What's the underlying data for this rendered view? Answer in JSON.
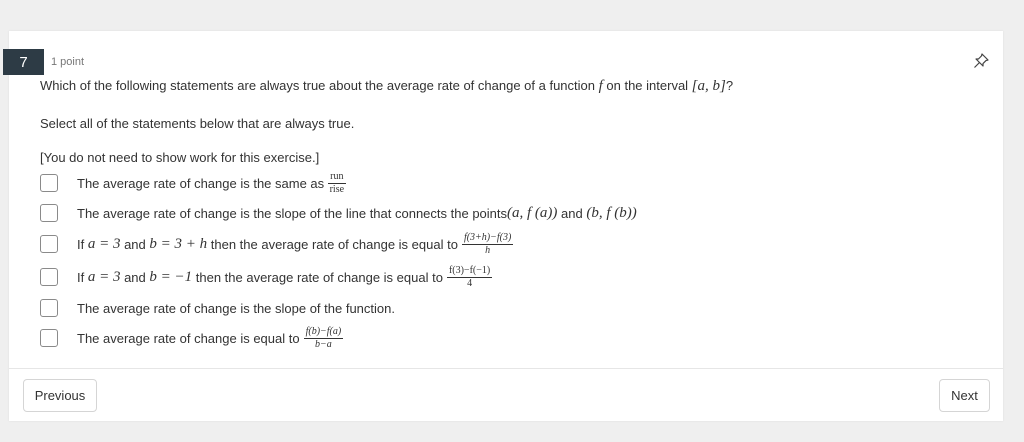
{
  "question": {
    "number": "7",
    "points": "1 point",
    "text_before": "Which of the following statements are always true about the average rate of change of a function ",
    "func": "f",
    "text_mid": " on the interval ",
    "interval": "[a, b]",
    "text_after": "?",
    "instruction": "Select all of the statements below that are always true.",
    "note": "[You do not need to show work for this exercise.]"
  },
  "options": [
    {
      "pre": "The average rate of change is the same as",
      "frac_num": "run",
      "frac_den": "rise"
    },
    {
      "pre": "The average rate of change is the slope of the line that connects the points ",
      "m1": "(a, f (a))",
      "mid": " and ",
      "m2": "(b, f (b))"
    },
    {
      "pre": "If ",
      "m1": "a = 3",
      "mid": " and ",
      "m2": "b = 3 + h",
      "post": " then the average rate of change is equal to",
      "frac_num": "f(3+h)−f(3)",
      "frac_den": "h"
    },
    {
      "pre": "If ",
      "m1": "a = 3",
      "mid": " and ",
      "m2": "b = −1",
      "post": " then the average rate of change is equal to",
      "frac_num": "f(3)−f(−1)",
      "frac_den": "4"
    },
    {
      "pre": "The average rate of change is the slope of the function."
    },
    {
      "pre": "The average rate of change is equal to",
      "frac_num": "f(b)−f(a)",
      "frac_den": "b−a"
    }
  ],
  "nav": {
    "previous": "Previous",
    "next": "Next"
  },
  "icons": {
    "pin": "pin-icon"
  }
}
